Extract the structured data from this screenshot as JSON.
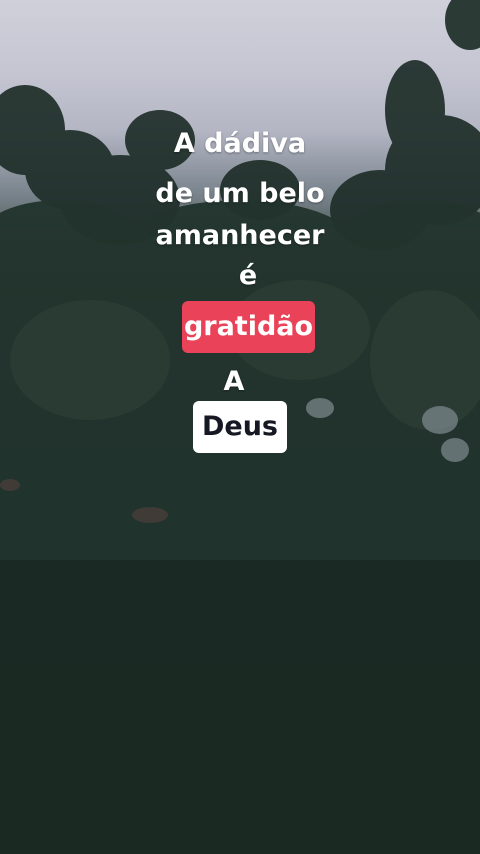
{
  "caption": {
    "line1": "A dádiva",
    "line2": "de um belo",
    "line3": "amanhecer",
    "line4": "é",
    "highlight_red": "gratidão",
    "line6": "A",
    "highlight_white": "Deus"
  },
  "colors": {
    "highlight_red_bg": "#ea4359",
    "highlight_white_bg": "#ffffff",
    "text": "#ffffff"
  }
}
